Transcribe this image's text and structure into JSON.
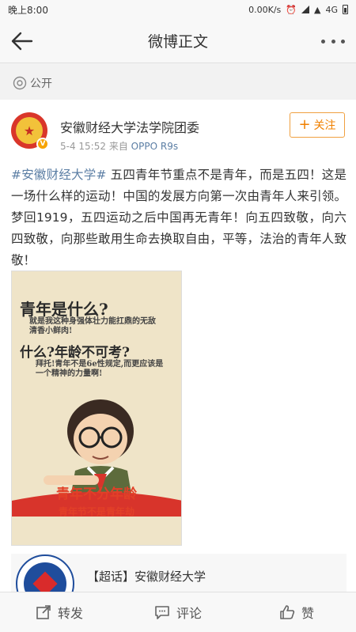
{
  "status_bar": {
    "time": "晚上8:00",
    "speed": "0.00K/s",
    "network": "4G"
  },
  "nav": {
    "title": "微博正文"
  },
  "visibility": {
    "label": "公开"
  },
  "post": {
    "author": "安徽财经大学法学院团委",
    "date": "5-4 15:52",
    "source_prefix": "来自",
    "source": "OPPO R9s",
    "follow_label": "关注",
    "topic": "#安徽财经大学#",
    "text": " 五四青年节重点不是青年，而是五四！这是一场什么样的运动！中国的发展方向第一次由青年人来引领。梦回1919，五四运动之后中国再无青年！向五四致敬，向六四致敬，向那些敢用生命去换取自由，平等，法治的青年人致敬！"
  },
  "poster": {
    "line1": "青年是什么?",
    "line2": "就是我这种身强体壮力能扛鼎的无敌清香小鲜肉!",
    "line3": "什么?年龄不可考?",
    "line4": "拜托!青年不是6e性规定,而更应该是一个精神的力量啊!",
    "banner1": "青年不分年龄",
    "banner2": "青年节不是青年劫"
  },
  "supertopic": {
    "label": "【超话】安徽财经大学"
  },
  "toolbar": {
    "repost": "转发",
    "comment": "评论",
    "like": "赞"
  },
  "colors": {
    "link": "#5b7ea4",
    "follow": "#f08000",
    "poster_red": "#e24028"
  }
}
